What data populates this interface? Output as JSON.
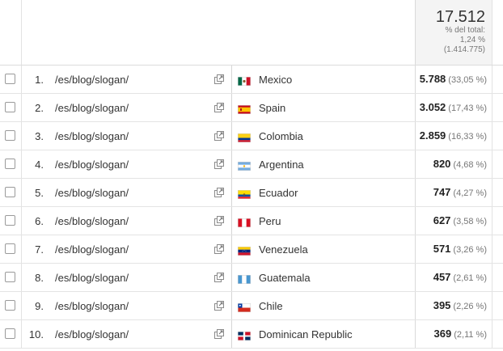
{
  "header": {
    "total": "17.512",
    "pct_label": "% del total:",
    "pct_value": "1,24 %",
    "pct_total": "(1.414.775)"
  },
  "rows": [
    {
      "index": "1.",
      "page": "/es/blog/slogan/",
      "country": "Mexico",
      "flag": "mexico",
      "value": "5.788",
      "pct": "(33,05 %)"
    },
    {
      "index": "2.",
      "page": "/es/blog/slogan/",
      "country": "Spain",
      "flag": "spain",
      "value": "3.052",
      "pct": "(17,43 %)"
    },
    {
      "index": "3.",
      "page": "/es/blog/slogan/",
      "country": "Colombia",
      "flag": "colombia",
      "value": "2.859",
      "pct": "(16,33 %)"
    },
    {
      "index": "4.",
      "page": "/es/blog/slogan/",
      "country": "Argentina",
      "flag": "argentina",
      "value": "820",
      "pct": "(4,68 %)"
    },
    {
      "index": "5.",
      "page": "/es/blog/slogan/",
      "country": "Ecuador",
      "flag": "ecuador",
      "value": "747",
      "pct": "(4,27 %)"
    },
    {
      "index": "6.",
      "page": "/es/blog/slogan/",
      "country": "Peru",
      "flag": "peru",
      "value": "627",
      "pct": "(3,58 %)"
    },
    {
      "index": "7.",
      "page": "/es/blog/slogan/",
      "country": "Venezuela",
      "flag": "venezuela",
      "value": "571",
      "pct": "(3,26 %)"
    },
    {
      "index": "8.",
      "page": "/es/blog/slogan/",
      "country": "Guatemala",
      "flag": "guatemala",
      "value": "457",
      "pct": "(2,61 %)"
    },
    {
      "index": "9.",
      "page": "/es/blog/slogan/",
      "country": "Chile",
      "flag": "chile",
      "value": "395",
      "pct": "(2,26 %)"
    },
    {
      "index": "10.",
      "page": "/es/blog/slogan/",
      "country": "Dominican Republic",
      "flag": "dominican-republic",
      "value": "369",
      "pct": "(2,11 %)"
    }
  ]
}
